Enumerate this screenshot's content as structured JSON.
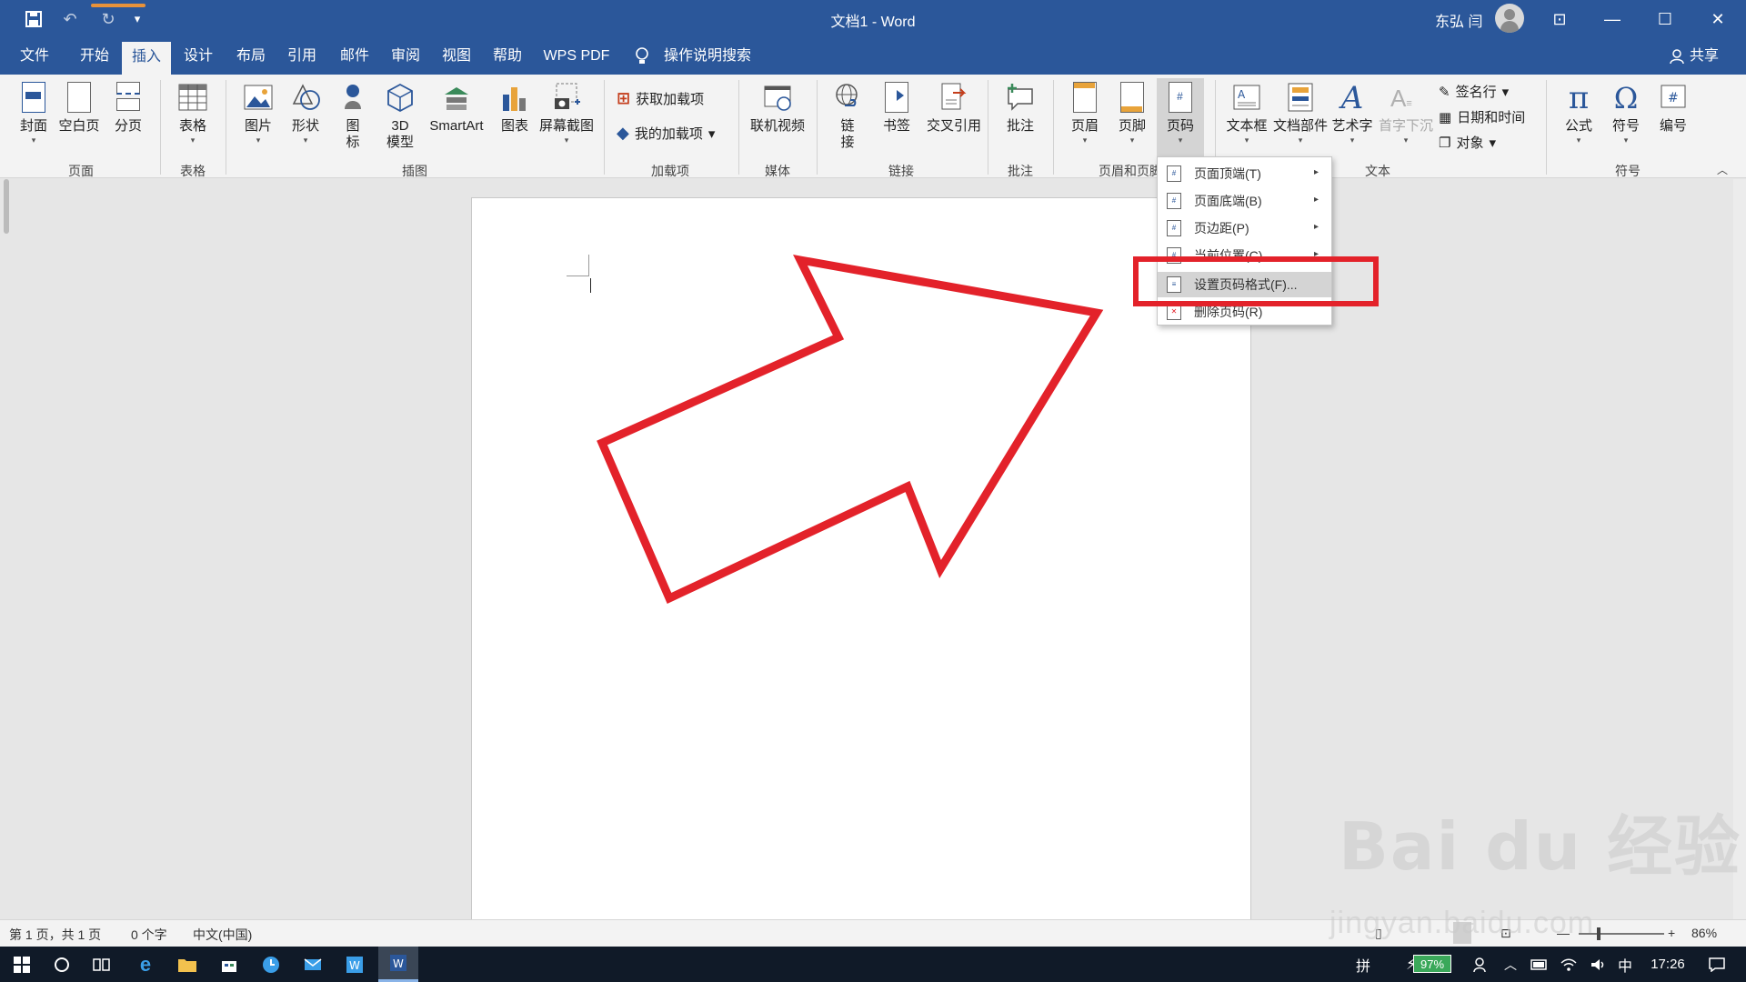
{
  "window": {
    "title": "文档1  -  Word",
    "user": "东弘 闫",
    "minimize": "—",
    "restore": "☐",
    "close": "✕",
    "ribbon_display": "⊡"
  },
  "quick_access": {
    "save": "💾",
    "undo": "↶",
    "redo": "↻",
    "customize": "▾"
  },
  "tabs": [
    "文件",
    "开始",
    "插入",
    "设计",
    "布局",
    "引用",
    "邮件",
    "审阅",
    "视图",
    "帮助",
    "WPS PDF"
  ],
  "active_tab": "插入",
  "tell_me": "操作说明搜索",
  "share": "共享",
  "ribbon": {
    "groups": {
      "pages": "页面",
      "tables": "表格",
      "illustrations": "插图",
      "addins": "加载项",
      "media": "媒体",
      "links": "链接",
      "comments": "批注",
      "header_footer": "页眉和页脚",
      "text": "文本",
      "symbols": "符号"
    },
    "buttons": {
      "cover": "封面",
      "blank_page": "空白页",
      "page_break": "分页",
      "table": "表格",
      "picture": "图片",
      "shapes": "形状",
      "icons_1": "图",
      "icons_2": "标",
      "model_1": "3D",
      "model_2": "模型",
      "smartart": "SmartArt",
      "chart": "图表",
      "screenshot": "屏幕截图",
      "get_addins": "获取加载项",
      "my_addins": "我的加载项",
      "online_video": "联机视频",
      "link_1": "链",
      "link_2": "接",
      "bookmark": "书签",
      "cross_ref": "交叉引用",
      "comment": "批注",
      "header": "页眉",
      "footer": "页脚",
      "page_number": "页码",
      "textbox": "文本框",
      "quick_parts": "文档部件",
      "wordart": "艺术字",
      "dropcap": "首字下沉",
      "signature_line": "签名行",
      "date_time": "日期和时间",
      "object": "对象",
      "equation": "公式",
      "symbol": "符号",
      "number": "编号"
    }
  },
  "page_number_menu": {
    "items": [
      {
        "label": "页面顶端(T)",
        "submenu": true
      },
      {
        "label": "页面底端(B)",
        "submenu": true
      },
      {
        "label": "页边距(P)",
        "submenu": true
      },
      {
        "label": "当前位置(C)",
        "submenu": true
      },
      {
        "label": "设置页码格式(F)...",
        "submenu": false
      },
      {
        "label": "删除页码(R)",
        "submenu": false
      }
    ],
    "selected_index": 4
  },
  "statusbar": {
    "page": "第 1 页，共 1 页",
    "words": "0 个字",
    "language": "中文(中国)",
    "zoom": "86%",
    "zoom_minus": "—",
    "zoom_plus": "+"
  },
  "taskbar": {
    "ime": "拼",
    "battery": "97%",
    "input_lang": "中",
    "time": "17:26"
  },
  "watermark": {
    "logo": "Bai du 经验",
    "url": "jingyan.baidu.com"
  },
  "colors": {
    "brand": "#2b579a",
    "annotation": "#e3222a"
  }
}
